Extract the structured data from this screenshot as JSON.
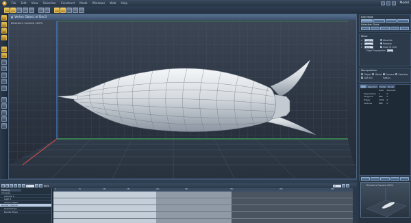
{
  "menubar": {
    "items": [
      "File",
      "Edit",
      "View",
      "Selection",
      "Construct",
      "Mode",
      "Windows",
      "Web",
      "Help"
    ],
    "workspace": "Model"
  },
  "viewport": {
    "title": "Vertex Object of Doc3",
    "camera": "Director's Camera 100%",
    "accent": "#3a5f9a"
  },
  "rightpanel": {
    "edit_mode_title": "Edit Mode",
    "selection_tools_title": "Selection Tools",
    "move_title": "Move",
    "fields": [
      {
        "axis": "x",
        "value": "-129.9"
      },
      {
        "axis": "y",
        "value": "-128.3"
      },
      {
        "axis": "z",
        "value": "-82.1"
      }
    ],
    "move_options": [
      "Absolute",
      "Relative",
      "Snap To Grid"
    ],
    "edge_propagation": "Edge Propagation",
    "edge_value": "100",
    "manipulation_title": "Manipulation",
    "manip_options": [
      "Object",
      "World",
      "Camera",
      "Selection",
      "Soft Sel",
      "Radius"
    ],
    "tabs": [
      "Info",
      "Selection",
      "Model",
      "Brush"
    ],
    "stats_header": [
      "",
      "Total",
      "Selected"
    ],
    "stats": [
      {
        "label": "Polymeshes",
        "total": "1",
        "selected": "0"
      },
      {
        "label": "Polygons",
        "total": "896",
        "selected": "0"
      },
      {
        "label": "Edges",
        "total": "1792",
        "selected": "0"
      },
      {
        "label": "Vertices",
        "total": "898",
        "selected": "0"
      }
    ],
    "nav_camera": "Director's Camera 100%"
  },
  "timeline": {
    "filter": "Filtering",
    "keys_label": "Keys",
    "field_start": "1",
    "field_end": "30",
    "ticks": [
      "0",
      "5s",
      "10s",
      "15s",
      "20s",
      "25s",
      "30s",
      "35s",
      "40s"
    ],
    "tree": [
      "Universe",
      "Camera 1",
      "Light 1",
      "Vertex Object",
      "Render Channel",
      "Global Props",
      "Render Props"
    ]
  }
}
